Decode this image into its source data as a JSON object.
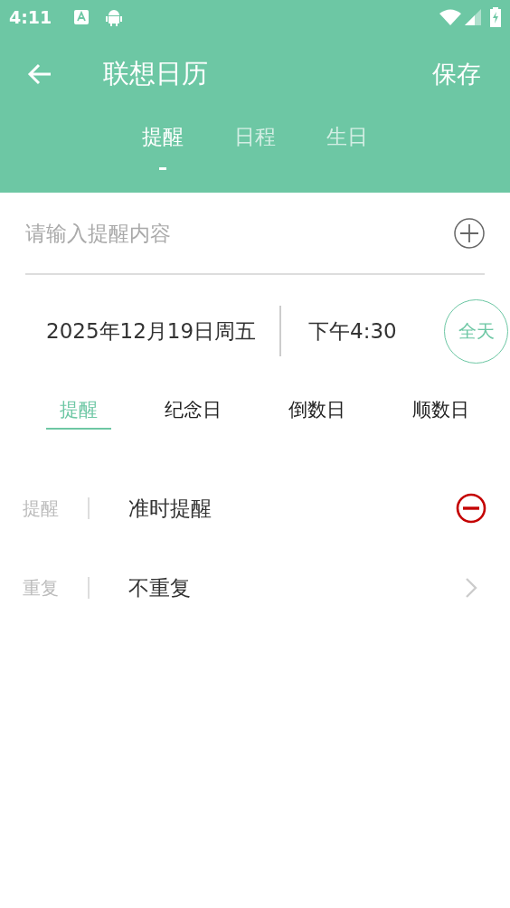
{
  "status_bar": {
    "time": "4:11"
  },
  "toolbar": {
    "title": "联想日历",
    "action": "保存"
  },
  "tabs": [
    {
      "label": "提醒",
      "selected": true
    },
    {
      "label": "日程",
      "selected": false
    },
    {
      "label": "生日",
      "selected": false
    }
  ],
  "input": {
    "placeholder": "请输入提醒内容"
  },
  "datetime": {
    "date": "2025年12月19日周五",
    "time": "下午4:30",
    "all_day": "全天"
  },
  "types": [
    {
      "label": "提醒",
      "selected": true
    },
    {
      "label": "纪念日",
      "selected": false
    },
    {
      "label": "倒数日",
      "selected": false
    },
    {
      "label": "顺数日",
      "selected": false
    }
  ],
  "settings": [
    {
      "label": "提醒",
      "value": "准时提醒",
      "kind": "remove"
    },
    {
      "label": "重复",
      "value": "不重复",
      "kind": "arrow"
    }
  ]
}
